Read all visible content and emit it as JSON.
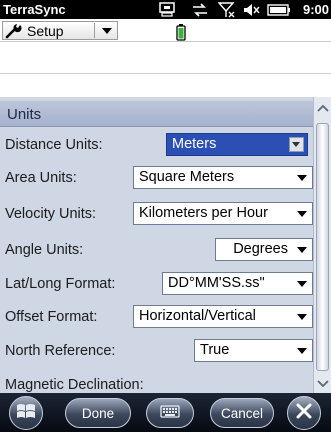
{
  "titlebar": {
    "app_title": "TerraSync",
    "clock": "9:00",
    "icons": [
      "device-icon",
      "sync-icon",
      "signal-off-icon",
      "volume-icon",
      "battery-icon"
    ]
  },
  "toolbar": {
    "setup_label": "Setup",
    "icons": [
      "wrench-icon",
      "dropdown-arrow-icon",
      "battery-status-icon"
    ]
  },
  "section": {
    "title": "Units"
  },
  "fields": [
    {
      "label": "Distance Units:",
      "value": "Meters",
      "focused": true
    },
    {
      "label": "Area Units:",
      "value": "Square Meters"
    },
    {
      "label": "Velocity Units:",
      "value": "Kilometers per Hour"
    },
    {
      "label": "Angle Units:",
      "value": "Degrees"
    },
    {
      "label": "Lat/Long Format:",
      "value": "DD°MM'SS.ss\""
    },
    {
      "label": "Offset Format:",
      "value": "Horizontal/Vertical"
    },
    {
      "label": "North Reference:",
      "value": "True"
    },
    {
      "label": "Magnetic Declination:",
      "value": ""
    }
  ],
  "bottombar": {
    "done_label": "Done",
    "cancel_label": "Cancel",
    "icons": [
      "windows-start-icon",
      "keyboard-icon",
      "close-icon"
    ]
  },
  "colors": {
    "panel": "#cfd6e4",
    "header": "#a6b2cc",
    "focus": "#2b4fb3",
    "bottombar": "#0c121e"
  }
}
